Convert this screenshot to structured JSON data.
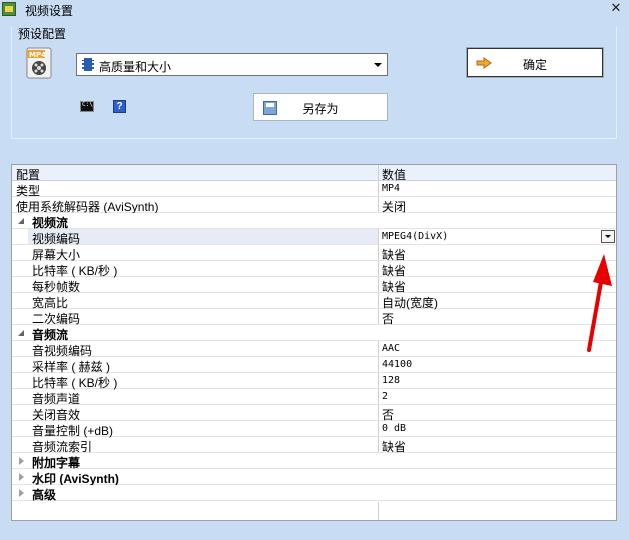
{
  "window": {
    "title": "视频设置",
    "close_glyph": "✕"
  },
  "preset": {
    "group_label": "预设配置",
    "selected": "高质量和大小",
    "ok_label": "确定",
    "save_as_label": "另存为",
    "icon_text": "MP4",
    "help_glyph": "?"
  },
  "grid": {
    "header": {
      "name": "配置",
      "value": "数值"
    },
    "rows": [
      {
        "name": "类型",
        "value": "MP4"
      },
      {
        "name": "使用系统解码器 (AviSynth)",
        "value": "关闭"
      }
    ],
    "video": {
      "label": "视频流",
      "rows": [
        {
          "name": "视频编码",
          "value": "MPEG4(DivX)"
        },
        {
          "name": "屏幕大小",
          "value": "缺省"
        },
        {
          "name": "比特率 ( KB/秒 )",
          "value": "缺省"
        },
        {
          "name": "每秒帧数",
          "value": "缺省"
        },
        {
          "name": "宽高比",
          "value": "自动(宽度)"
        },
        {
          "name": "二次编码",
          "value": "否"
        }
      ]
    },
    "audio": {
      "label": "音频流",
      "rows": [
        {
          "name": "音视频编码",
          "value": "AAC"
        },
        {
          "name": "采样率 ( 赫兹 )",
          "value": "44100"
        },
        {
          "name": "比特率 ( KB/秒 )",
          "value": "128"
        },
        {
          "name": "音频声道",
          "value": "2"
        },
        {
          "name": "关闭音效",
          "value": "否"
        },
        {
          "name": "音量控制 (+dB)",
          "value": "0 dB"
        },
        {
          "name": "音频流索引",
          "value": "缺省"
        }
      ]
    },
    "collapsed": [
      {
        "label": "附加字幕"
      },
      {
        "label": "水印 (AviSynth)"
      },
      {
        "label": "高级"
      }
    ]
  },
  "colors": {
    "window_bg": "#c8dcf4",
    "header_bg": "#eaf1fb",
    "arrow": "#e60000"
  }
}
